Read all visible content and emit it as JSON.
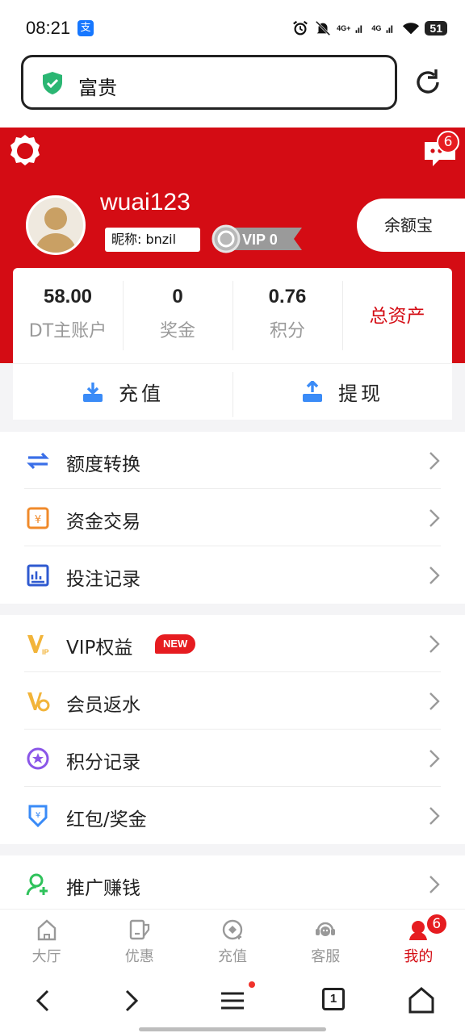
{
  "status_bar": {
    "time": "08:21",
    "alipay": "支",
    "signal1": "4G+",
    "signal2": "4G",
    "battery": "51"
  },
  "url_bar": {
    "text": "富贵"
  },
  "header": {
    "notification_count": "6",
    "username": "wuai123",
    "nickname": "昵称: bnzil",
    "vip_level": "VIP 0",
    "yeb_label": "余额宝"
  },
  "stats": [
    {
      "value": "58.00",
      "label": "DT主账户"
    },
    {
      "value": "0",
      "label": "奖金"
    },
    {
      "value": "0.76",
      "label": "积分"
    }
  ],
  "total_assets": "总资产",
  "actions": {
    "recharge": "充值",
    "withdraw": "提现"
  },
  "menu_group1": [
    {
      "label": "额度转换",
      "icon": "transfer-icon"
    },
    {
      "label": "资金交易",
      "icon": "money-trade-icon"
    },
    {
      "label": "投注记录",
      "icon": "bet-record-icon"
    }
  ],
  "menu_group2": [
    {
      "label": "VIP权益",
      "icon": "vip-icon",
      "badge": "NEW"
    },
    {
      "label": "会员返水",
      "icon": "rebate-icon"
    },
    {
      "label": "积分记录",
      "icon": "points-icon"
    },
    {
      "label": "红包/奖金",
      "icon": "red-envelope-icon"
    }
  ],
  "menu_group3": [
    {
      "label": "推广赚钱",
      "icon": "promote-icon"
    }
  ],
  "tabbar": [
    {
      "label": "大厅",
      "icon": "home-icon"
    },
    {
      "label": "优惠",
      "icon": "coupon-icon"
    },
    {
      "label": "充值",
      "icon": "deposit-icon"
    },
    {
      "label": "客服",
      "icon": "support-icon"
    },
    {
      "label": "我的",
      "icon": "profile-icon",
      "badge": "6",
      "active": true
    }
  ],
  "browser_nav": {
    "tab_count": "1"
  },
  "colors": {
    "brand_red": "#d40c14",
    "badge_red": "#e61c20",
    "secure_green": "#2bb673"
  }
}
